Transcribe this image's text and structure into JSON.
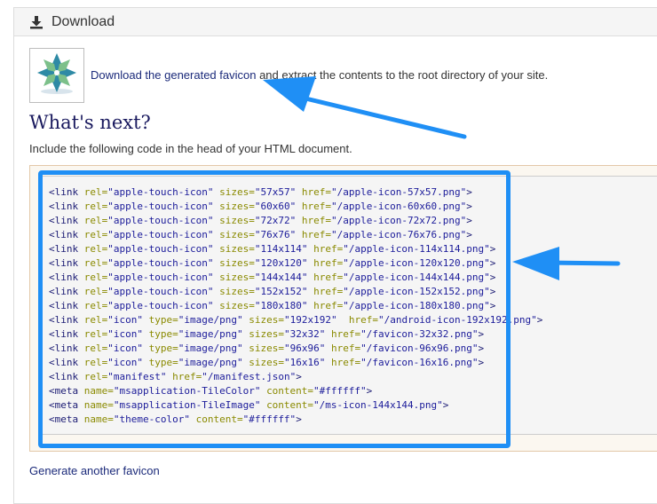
{
  "panel": {
    "title": "Download",
    "icon": "download-icon"
  },
  "intro": {
    "link_text": "Download the generated favicon",
    "rest_text": " and extract the contents to the root directory of your site."
  },
  "whats_next": "What's next?",
  "include_text": "Include the following code in the head of your HTML document.",
  "code_lines": [
    [
      [
        "t",
        "<link "
      ],
      [
        "a",
        "rel="
      ],
      [
        "v",
        "\"apple-touch-icon\" "
      ],
      [
        "a",
        "sizes="
      ],
      [
        "v",
        "\"57x57\" "
      ],
      [
        "a",
        "href="
      ],
      [
        "v",
        "\"/apple-icon-57x57.png\""
      ],
      [
        "t",
        ">"
      ]
    ],
    [
      [
        "t",
        "<link "
      ],
      [
        "a",
        "rel="
      ],
      [
        "v",
        "\"apple-touch-icon\" "
      ],
      [
        "a",
        "sizes="
      ],
      [
        "v",
        "\"60x60\" "
      ],
      [
        "a",
        "href="
      ],
      [
        "v",
        "\"/apple-icon-60x60.png\""
      ],
      [
        "t",
        ">"
      ]
    ],
    [
      [
        "t",
        "<link "
      ],
      [
        "a",
        "rel="
      ],
      [
        "v",
        "\"apple-touch-icon\" "
      ],
      [
        "a",
        "sizes="
      ],
      [
        "v",
        "\"72x72\" "
      ],
      [
        "a",
        "href="
      ],
      [
        "v",
        "\"/apple-icon-72x72.png\""
      ],
      [
        "t",
        ">"
      ]
    ],
    [
      [
        "t",
        "<link "
      ],
      [
        "a",
        "rel="
      ],
      [
        "v",
        "\"apple-touch-icon\" "
      ],
      [
        "a",
        "sizes="
      ],
      [
        "v",
        "\"76x76\" "
      ],
      [
        "a",
        "href="
      ],
      [
        "v",
        "\"/apple-icon-76x76.png\""
      ],
      [
        "t",
        ">"
      ]
    ],
    [
      [
        "t",
        "<link "
      ],
      [
        "a",
        "rel="
      ],
      [
        "v",
        "\"apple-touch-icon\" "
      ],
      [
        "a",
        "sizes="
      ],
      [
        "v",
        "\"114x114\" "
      ],
      [
        "a",
        "href="
      ],
      [
        "v",
        "\"/apple-icon-114x114.png\""
      ],
      [
        "t",
        ">"
      ]
    ],
    [
      [
        "t",
        "<link "
      ],
      [
        "a",
        "rel="
      ],
      [
        "v",
        "\"apple-touch-icon\" "
      ],
      [
        "a",
        "sizes="
      ],
      [
        "v",
        "\"120x120\" "
      ],
      [
        "a",
        "href="
      ],
      [
        "v",
        "\"/apple-icon-120x120.png\""
      ],
      [
        "t",
        ">"
      ]
    ],
    [
      [
        "t",
        "<link "
      ],
      [
        "a",
        "rel="
      ],
      [
        "v",
        "\"apple-touch-icon\" "
      ],
      [
        "a",
        "sizes="
      ],
      [
        "v",
        "\"144x144\" "
      ],
      [
        "a",
        "href="
      ],
      [
        "v",
        "\"/apple-icon-144x144.png\""
      ],
      [
        "t",
        ">"
      ]
    ],
    [
      [
        "t",
        "<link "
      ],
      [
        "a",
        "rel="
      ],
      [
        "v",
        "\"apple-touch-icon\" "
      ],
      [
        "a",
        "sizes="
      ],
      [
        "v",
        "\"152x152\" "
      ],
      [
        "a",
        "href="
      ],
      [
        "v",
        "\"/apple-icon-152x152.png\""
      ],
      [
        "t",
        ">"
      ]
    ],
    [
      [
        "t",
        "<link "
      ],
      [
        "a",
        "rel="
      ],
      [
        "v",
        "\"apple-touch-icon\" "
      ],
      [
        "a",
        "sizes="
      ],
      [
        "v",
        "\"180x180\" "
      ],
      [
        "a",
        "href="
      ],
      [
        "v",
        "\"/apple-icon-180x180.png\""
      ],
      [
        "t",
        ">"
      ]
    ],
    [
      [
        "t",
        "<link "
      ],
      [
        "a",
        "rel="
      ],
      [
        "v",
        "\"icon\" "
      ],
      [
        "a",
        "type="
      ],
      [
        "v",
        "\"image/png\" "
      ],
      [
        "a",
        "sizes="
      ],
      [
        "v",
        "\"192x192\"  "
      ],
      [
        "a",
        "href="
      ],
      [
        "v",
        "\"/android-icon-192x192.png\""
      ],
      [
        "t",
        ">"
      ]
    ],
    [
      [
        "t",
        "<link "
      ],
      [
        "a",
        "rel="
      ],
      [
        "v",
        "\"icon\" "
      ],
      [
        "a",
        "type="
      ],
      [
        "v",
        "\"image/png\" "
      ],
      [
        "a",
        "sizes="
      ],
      [
        "v",
        "\"32x32\" "
      ],
      [
        "a",
        "href="
      ],
      [
        "v",
        "\"/favicon-32x32.png\""
      ],
      [
        "t",
        ">"
      ]
    ],
    [
      [
        "t",
        "<link "
      ],
      [
        "a",
        "rel="
      ],
      [
        "v",
        "\"icon\" "
      ],
      [
        "a",
        "type="
      ],
      [
        "v",
        "\"image/png\" "
      ],
      [
        "a",
        "sizes="
      ],
      [
        "v",
        "\"96x96\" "
      ],
      [
        "a",
        "href="
      ],
      [
        "v",
        "\"/favicon-96x96.png\""
      ],
      [
        "t",
        ">"
      ]
    ],
    [
      [
        "t",
        "<link "
      ],
      [
        "a",
        "rel="
      ],
      [
        "v",
        "\"icon\" "
      ],
      [
        "a",
        "type="
      ],
      [
        "v",
        "\"image/png\" "
      ],
      [
        "a",
        "sizes="
      ],
      [
        "v",
        "\"16x16\" "
      ],
      [
        "a",
        "href="
      ],
      [
        "v",
        "\"/favicon-16x16.png\""
      ],
      [
        "t",
        ">"
      ]
    ],
    [
      [
        "t",
        "<link "
      ],
      [
        "a",
        "rel="
      ],
      [
        "v",
        "\"manifest\" "
      ],
      [
        "a",
        "href="
      ],
      [
        "v",
        "\"/manifest.json\""
      ],
      [
        "t",
        ">"
      ]
    ],
    [
      [
        "t",
        "<meta "
      ],
      [
        "a",
        "name="
      ],
      [
        "v",
        "\"msapplication-TileColor\" "
      ],
      [
        "a",
        "content="
      ],
      [
        "v",
        "\"#ffffff\""
      ],
      [
        "t",
        ">"
      ]
    ],
    [
      [
        "t",
        "<meta "
      ],
      [
        "a",
        "name="
      ],
      [
        "v",
        "\"msapplication-TileImage\" "
      ],
      [
        "a",
        "content="
      ],
      [
        "v",
        "\"/ms-icon-144x144.png\""
      ],
      [
        "t",
        ">"
      ]
    ],
    [
      [
        "t",
        "<meta "
      ],
      [
        "a",
        "name="
      ],
      [
        "v",
        "\"theme-color\" "
      ],
      [
        "a",
        "content="
      ],
      [
        "v",
        "\"#ffffff\""
      ],
      [
        "t",
        ">"
      ]
    ]
  ],
  "generate_link": "Generate another favicon",
  "colors": {
    "link": "#1b2a7a",
    "heading": "#19195e",
    "highlight": "#1f8ff5",
    "code_attr": "#8a8a00"
  }
}
